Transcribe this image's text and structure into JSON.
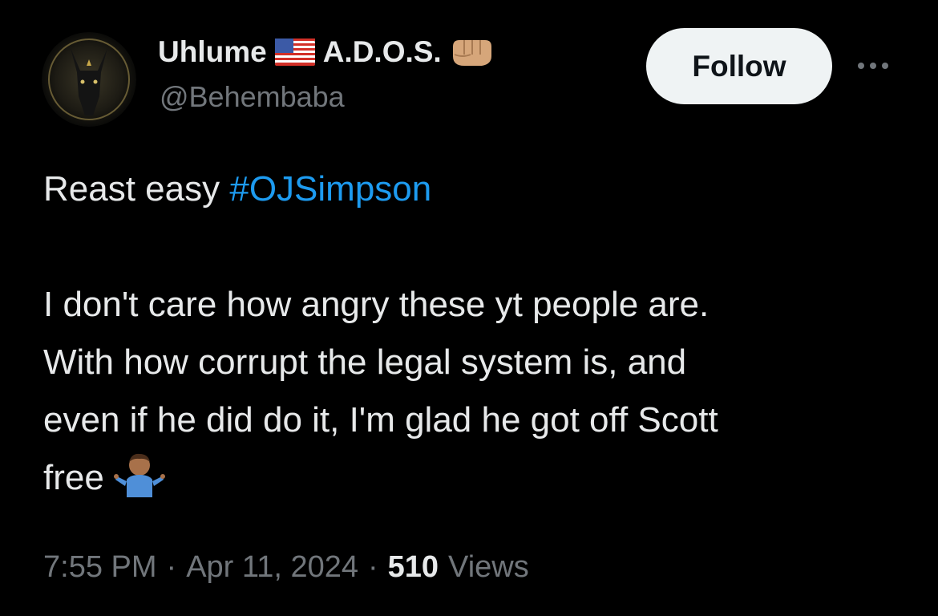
{
  "author": {
    "display_name": "Uhlume",
    "name_suffix": "A.D.O.S.",
    "flag_icon": "us-flag-icon",
    "suffix_icon": "fist-icon",
    "handle": "@Behembaba",
    "avatar_icon": "jackal-avatar"
  },
  "actions": {
    "follow_label": "Follow",
    "more_icon": "more-icon"
  },
  "tweet": {
    "line1_text": "Reast easy ",
    "hashtag": "#OJSimpson",
    "lines": [
      "I don't care how angry these yt people are.",
      "With how corrupt the legal system is, and",
      "even if he did do it, I'm glad he got off Scott"
    ],
    "last_line": "free",
    "emoji_icon": "person-shrugging-icon"
  },
  "meta": {
    "time": "7:55 PM",
    "separator": "·",
    "date": "Apr 11, 2024",
    "views_count": "510",
    "views_label": "Views"
  },
  "colors": {
    "background": "#000000",
    "text": "#e7e9ea",
    "secondary": "#71767b",
    "link": "#1d9bf0",
    "button_bg": "#eff3f4"
  }
}
